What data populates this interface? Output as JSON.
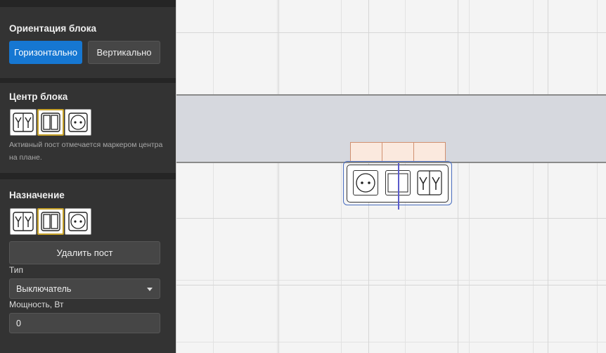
{
  "orientation": {
    "title": "Ориентация блока",
    "horizontal_label": "Горизонтально",
    "vertical_label": "Вертикально",
    "selected": "Горизонтально"
  },
  "center": {
    "title": "Центр блока",
    "options": [
      "double-switch-icon",
      "blank-frame-icon",
      "socket-icon"
    ],
    "active_index": 1,
    "hint": "Активный пост отмечается маркером центра на плане."
  },
  "purpose": {
    "title": "Назначение",
    "options": [
      "double-switch-icon",
      "blank-frame-icon",
      "socket-icon"
    ],
    "active_index": 1,
    "delete_label": "Удалить пост",
    "type_label": "Тип",
    "type_value": "Выключатель",
    "power_label": "Мощность, Вт",
    "power_value": "0"
  },
  "plan": {
    "block_posts": [
      "socket-icon",
      "blank-frame-icon",
      "double-switch-icon"
    ],
    "colors": {
      "wall": "#d6d8de",
      "selection": "#4a6ec0",
      "accent": "#1677d2",
      "active_border": "#c8a32a"
    }
  }
}
